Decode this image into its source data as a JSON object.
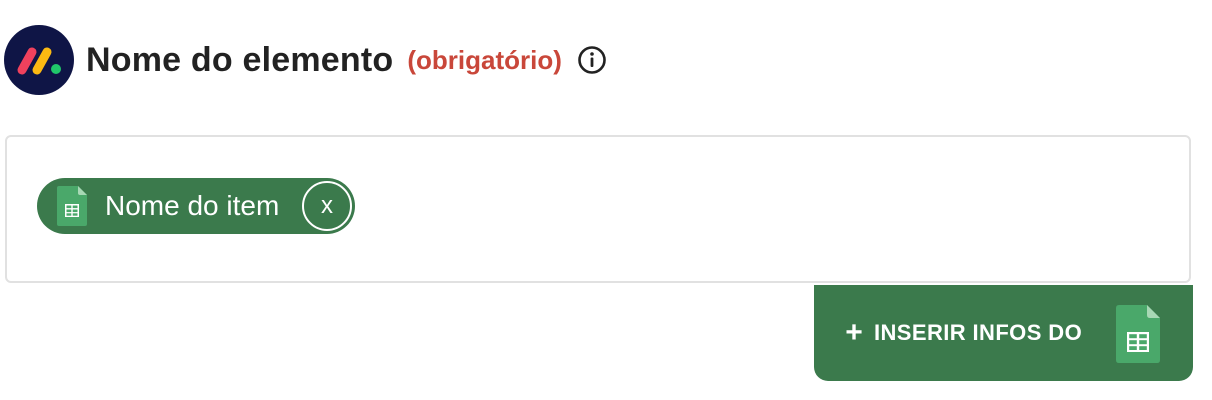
{
  "header": {
    "title": "Nome do elemento",
    "required_label": "(obrigatório)",
    "logo_icon": "monday-logo-icon",
    "info_icon": "info-icon"
  },
  "field": {
    "chip": {
      "label": "Nome do item",
      "icon": "google-sheets-icon",
      "remove_label": "x"
    }
  },
  "insert_button": {
    "plus": "+",
    "label": "INSERIR INFOS DO",
    "icon": "google-sheets-icon"
  },
  "colors": {
    "accent_green": "#3b7a4c",
    "required_red": "#c9473a",
    "logo_bg": "#0f1546",
    "border": "#e1e1e1"
  }
}
